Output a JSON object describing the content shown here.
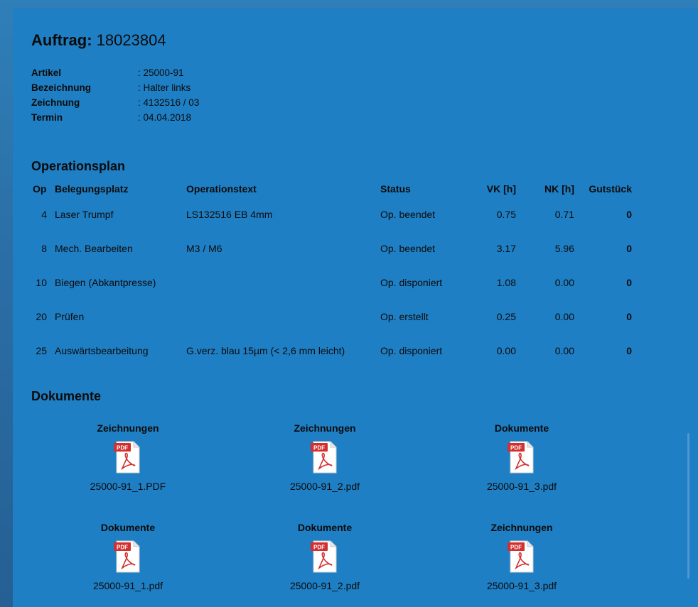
{
  "order": {
    "label": "Auftrag:",
    "number": "18023804"
  },
  "meta": [
    {
      "key": "Artikel",
      "value": ":  25000-91"
    },
    {
      "key": "Bezeichnung",
      "value": ":  Halter links"
    },
    {
      "key": "Zeichnung",
      "value": ":  4132516 / 03"
    },
    {
      "key": "Termin",
      "value": ":  04.04.2018"
    }
  ],
  "operations": {
    "title": "Operationsplan",
    "headers": {
      "op": "Op",
      "belegungsplatz": "Belegungsplatz",
      "operationstext": "Operationstext",
      "status": "Status",
      "vk": "VK [h]",
      "nk": "NK [h]",
      "gutstueck": "Gutstück"
    },
    "rows": [
      {
        "op": "4",
        "bp": "Laser Trumpf",
        "ot": "LS132516  EB  4mm",
        "st": "Op. beendet",
        "vk": "0.75",
        "nk": "0.71",
        "gs": "0"
      },
      {
        "op": "8",
        "bp": "Mech. Bearbeiten",
        "ot": "M3 / M6",
        "st": "Op. beendet",
        "vk": "3.17",
        "nk": "5.96",
        "gs": "0"
      },
      {
        "op": "10",
        "bp": "Biegen (Abkantpresse)",
        "ot": "",
        "st": "Op. disponiert",
        "vk": "1.08",
        "nk": "0.00",
        "gs": "0"
      },
      {
        "op": "20",
        "bp": "Prüfen",
        "ot": "",
        "st": "Op. erstellt",
        "vk": "0.25",
        "nk": "0.00",
        "gs": "0"
      },
      {
        "op": "25",
        "bp": "Auswärtsbearbeitung",
        "ot": "G.verz. blau 15µm (< 2,6 mm leicht)",
        "st": "Op. disponiert",
        "vk": "0.00",
        "nk": "0.00",
        "gs": "0"
      }
    ]
  },
  "documents": {
    "title": "Dokumente",
    "icon": "pdf-file-icon",
    "icon_badge": "PDF",
    "items": [
      {
        "category": "Zeichnungen",
        "filename": "25000-91_1.PDF"
      },
      {
        "category": "Zeichnungen",
        "filename": "25000-91_2.pdf"
      },
      {
        "category": "Dokumente",
        "filename": "25000-91_3.pdf"
      },
      {
        "category": "Dokumente",
        "filename": "25000-91_1.pdf"
      },
      {
        "category": "Dokumente",
        "filename": "25000-91_2.pdf"
      },
      {
        "category": "Zeichnungen",
        "filename": "25000-91_3.pdf"
      }
    ]
  },
  "colors": {
    "panel_bg": "#1f7fc4",
    "pdf_red": "#d32f2f"
  }
}
